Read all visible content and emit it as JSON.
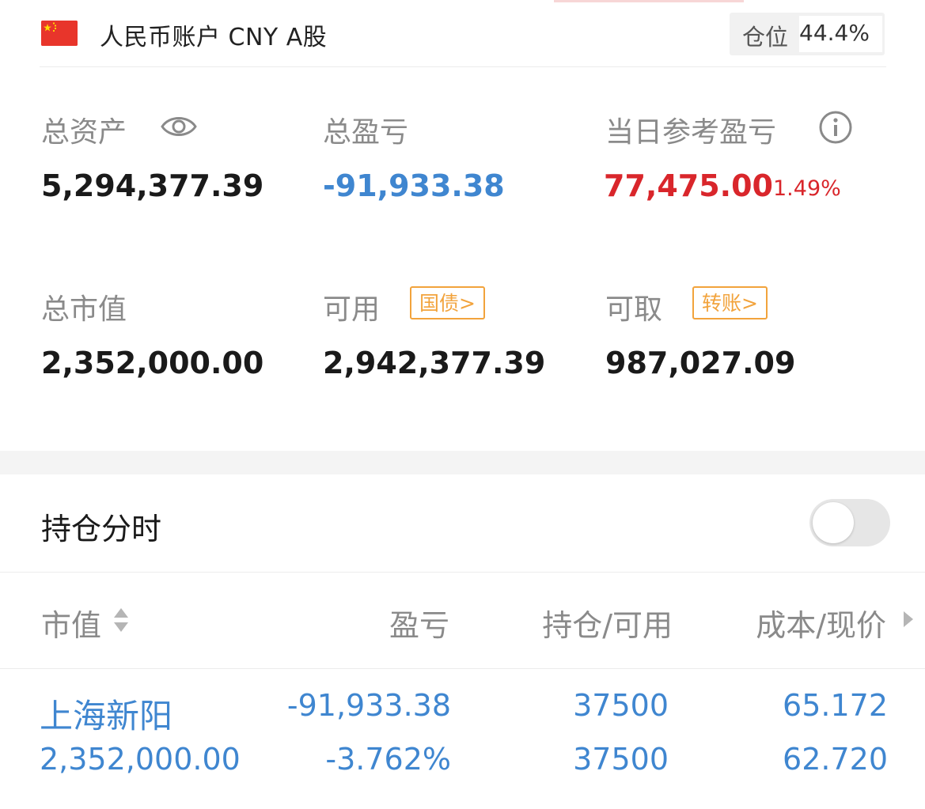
{
  "account": {
    "title": "人民币账户 CNY A股",
    "position_label": "仓位",
    "position_value": "44.4%"
  },
  "summary": {
    "total_assets_label": "总资产",
    "total_assets_value": "5,294,377.39",
    "total_pl_label": "总盈亏",
    "total_pl_value": "-91,933.38",
    "daily_pl_label": "当日参考盈亏",
    "daily_pl_value": "77,475.00",
    "daily_pl_pct": "1.49%",
    "market_value_label": "总市值",
    "market_value_value": "2,352,000.00",
    "available_label": "可用",
    "available_tag": "国债>",
    "available_value": "2,942,377.39",
    "withdrawable_label": "可取",
    "withdrawable_tag": "转账>",
    "withdrawable_value": "987,027.09"
  },
  "holdings_section": {
    "title": "持仓分时",
    "toggle_on": false
  },
  "table": {
    "headers": [
      "市值",
      "盈亏",
      "持仓/可用",
      "成本/现价"
    ],
    "rows": [
      {
        "name": "上海新阳",
        "market_value": "2,352,000.00",
        "pl": "-91,933.38",
        "pl_pct": "-3.762%",
        "position": "37500",
        "available": "37500",
        "cost": "65.172",
        "price": "62.720"
      }
    ]
  },
  "colors": {
    "negative": "#3f86d0",
    "positive": "#d9262b",
    "tag": "#f2a33c"
  }
}
